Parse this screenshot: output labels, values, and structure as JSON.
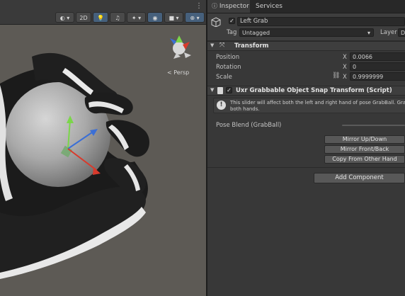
{
  "scene": {
    "toolbar": {
      "mode_2d_label": "2D",
      "menu_dots": "⋮"
    },
    "view_label": "< Persp",
    "gizmo_axes": [
      "x",
      "y",
      "z"
    ]
  },
  "inspector": {
    "tabs": [
      {
        "label": "Inspector",
        "icon": "info-icon"
      },
      {
        "label": "Services"
      }
    ],
    "object": {
      "name": "Left Grab",
      "active": true,
      "tag_label": "Tag",
      "tag_value": "Untagged",
      "layer_label": "Layer",
      "layer_value": "D"
    },
    "transform": {
      "title": "Transform",
      "position_label": "Position",
      "position_x": "0.0066",
      "rotation_label": "Rotation",
      "rotation_x": "0",
      "scale_label": "Scale",
      "scale_x": "0.9999999",
      "axis_x": "X"
    },
    "script": {
      "title": "Uxr Grabbable Object Snap Transform (Script)",
      "enabled": true,
      "help_text": "This slider will affect both the left and right hand of pose GrabBall. Grab po... both hands.",
      "help_line1": "This slider will affect both the left and right hand of pose GrabBall. Grab po",
      "help_line2": "both hands.",
      "pose_blend_label": "Pose Blend (GrabBall)",
      "pose_blend_value": 0,
      "buttons": [
        "Mirror Up/Down",
        "Mirror Front/Back",
        "Copy From Other Hand"
      ]
    },
    "add_component_label": "Add Component"
  },
  "colors": {
    "scene_bg": "#5d5a55",
    "panel_bg": "#383838",
    "active_tool": "#46607c",
    "axis_x": "#d83a2c",
    "axis_y": "#7bd64a",
    "axis_z": "#3b6fd6"
  }
}
